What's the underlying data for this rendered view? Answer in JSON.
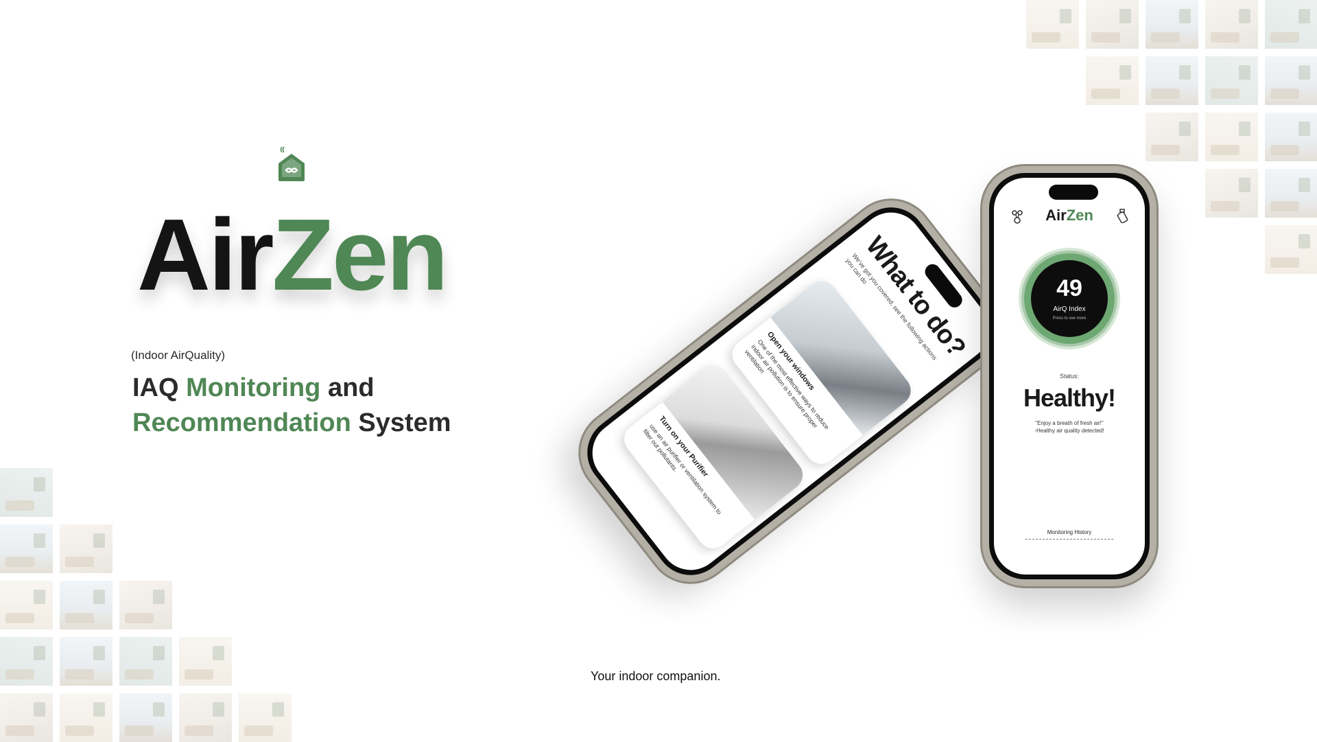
{
  "brand": {
    "name_part1": "Air",
    "name_part2": "Zen",
    "accent_color": "#4f8755",
    "logo_icon": "house-infinity-icon"
  },
  "subtitle": {
    "small": "(Indoor AirQuality)",
    "line1_a": "IAQ",
    "line1_b": "Monitoring",
    "line1_c": "and",
    "line2_a": "Recommendation",
    "line2_b": "System"
  },
  "tagline": "Your indoor companion.",
  "phone_home": {
    "title_part1": "Air",
    "title_part2": "Zen",
    "aqi_value": "49",
    "aqi_label": "AirQ Index",
    "aqi_hint": "Press to see more",
    "status_label": "Status:",
    "status_value": "Healthy!",
    "quote_line1": "\"Enjoy a breath of fresh air!\"",
    "quote_line2": "-Healthy air quality detected!",
    "history_label": "Monitoring History",
    "left_icon": "nodes-icon",
    "right_icon": "spray-icon"
  },
  "phone_todo": {
    "title": "What to do?",
    "subtitle": "We've got you covered, see the following actions you can do",
    "cards": [
      {
        "title": "Open your windows",
        "body": "One of the most effective ways to reduce indoor air pollution is to ensure proper ventilation"
      },
      {
        "title": "Turn on your Purifier",
        "body": "use an air purifier or ventilation system to filter out pollutants."
      }
    ]
  }
}
